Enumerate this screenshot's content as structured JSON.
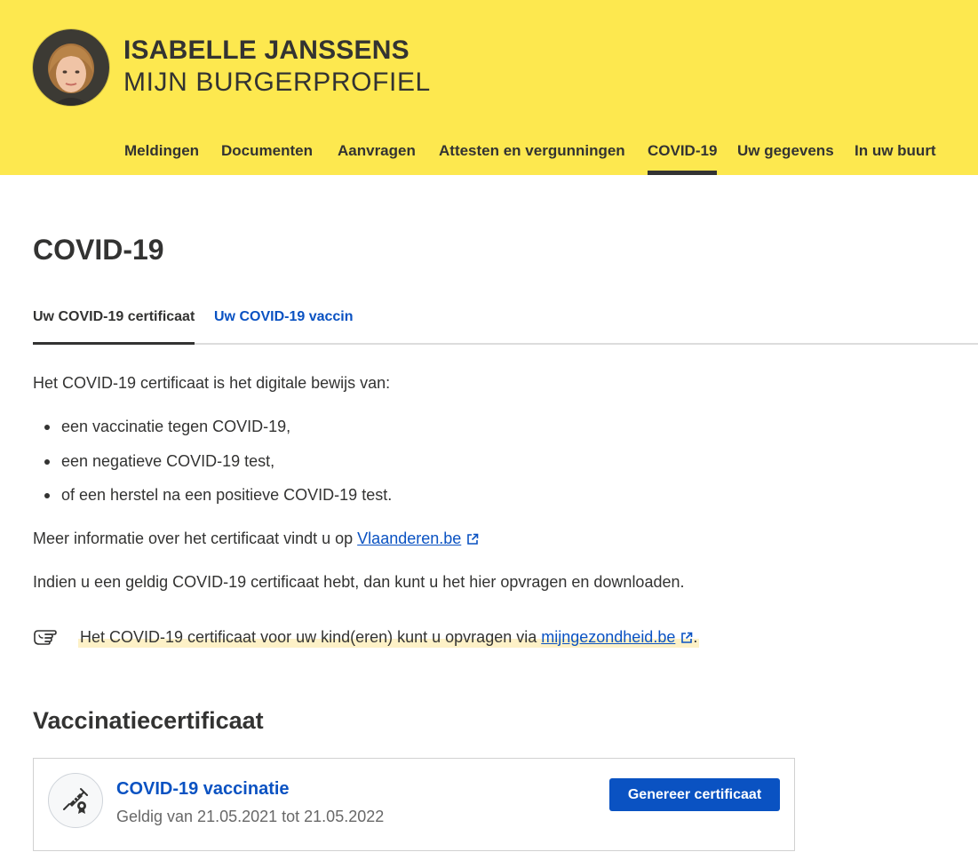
{
  "header": {
    "user_name": "ISABELLE JANSSENS",
    "profile_title": "MIJN BURGERPROFIEL",
    "background_color": "#fde84f",
    "nav": [
      {
        "label": "Meldingen",
        "active": false
      },
      {
        "label": "Documenten",
        "active": false
      },
      {
        "label": "Aanvragen",
        "active": false
      },
      {
        "label": "Attesten en vergunningen",
        "active": false
      },
      {
        "label": "COVID-19",
        "active": true
      },
      {
        "label": "Uw gegevens",
        "active": false
      },
      {
        "label": "In uw buurt",
        "active": false
      }
    ]
  },
  "main": {
    "page_title": "COVID-19",
    "tabs": [
      {
        "label": "Uw COVID-19 certificaat",
        "active": true
      },
      {
        "label": "Uw COVID-19 vaccin",
        "active": false
      }
    ],
    "intro": "Het COVID-19 certificaat is het digitale bewijs van:",
    "bullets": [
      "een vaccinatie tegen COVID-19,",
      "een negatieve COVID-19 test,",
      "of een herstel na een positieve COVID-19 test."
    ],
    "more_info": {
      "text": "Meer informatie over het certificaat vindt u op ",
      "link_label": "Vlaanderen.be"
    },
    "download_text": "Indien u een geldig COVID-19 certificaat hebt, dan kunt u het hier opvragen en downloaden.",
    "hint": {
      "text": "Het COVID-19 certificaat voor uw kind(eren) kunt u opvragen via ",
      "link_label": "mijngezondheid.be",
      "suffix": "."
    },
    "section_title": "Vaccinatiecertificaat",
    "certificate": {
      "title": "COVID-19 vaccinatie",
      "validity": "Geldig van 21.05.2021 tot 21.05.2022",
      "button_label": "Genereer certificaat",
      "icon": "vaccine-certificate-icon"
    }
  },
  "colors": {
    "accent": "#0a52c2",
    "text": "#333332",
    "header": "#fde84f",
    "highlight": "#fdf1c7"
  }
}
